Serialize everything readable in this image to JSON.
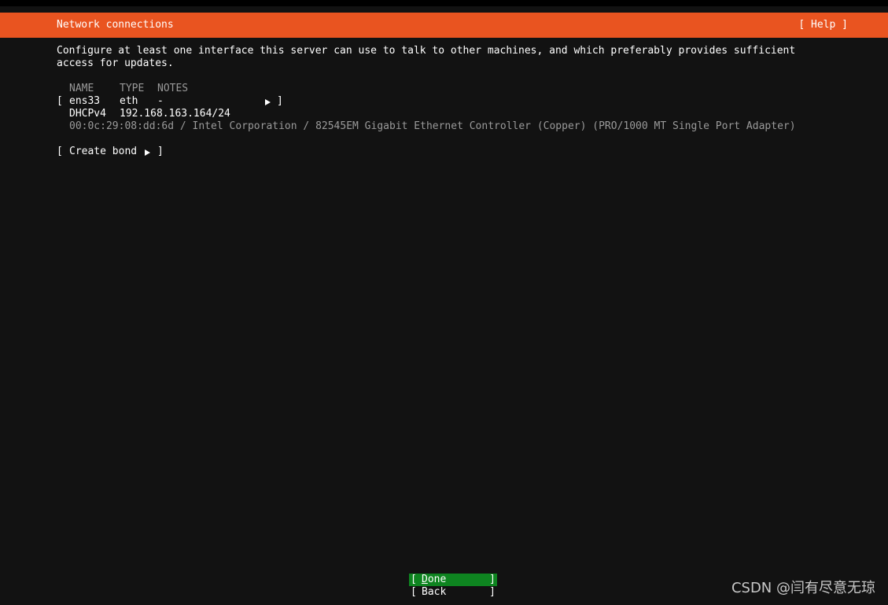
{
  "header": {
    "title": "Network connections",
    "help_label": "[ Help ]"
  },
  "description": "Configure at least one interface this server can use to talk to other machines, and which preferably provides sufficient access for updates.",
  "table": {
    "headers": {
      "name": "NAME",
      "type": "TYPE",
      "notes": "NOTES"
    },
    "interfaces": [
      {
        "name": "ens33",
        "type": "eth",
        "notes": "-",
        "address_method": "DHCPv4",
        "address": "192.168.163.164/24",
        "hw_info": "00:0c:29:08:dd:6d / Intel Corporation / 82545EM Gigabit Ethernet Controller (Copper) (PRO/1000 MT Single Port Adapter)"
      }
    ]
  },
  "create_bond_label": "Create bond",
  "brackets": {
    "open": "[",
    "close": "]"
  },
  "buttons": {
    "done_first": "D",
    "done_rest": "one",
    "back": "Back"
  },
  "watermark": "CSDN @闫有尽意无琼",
  "colors": {
    "header_bg": "#e95420",
    "background": "#121212",
    "selected_button_bg": "#0e8420",
    "dim_text": "#9a9a9a"
  }
}
